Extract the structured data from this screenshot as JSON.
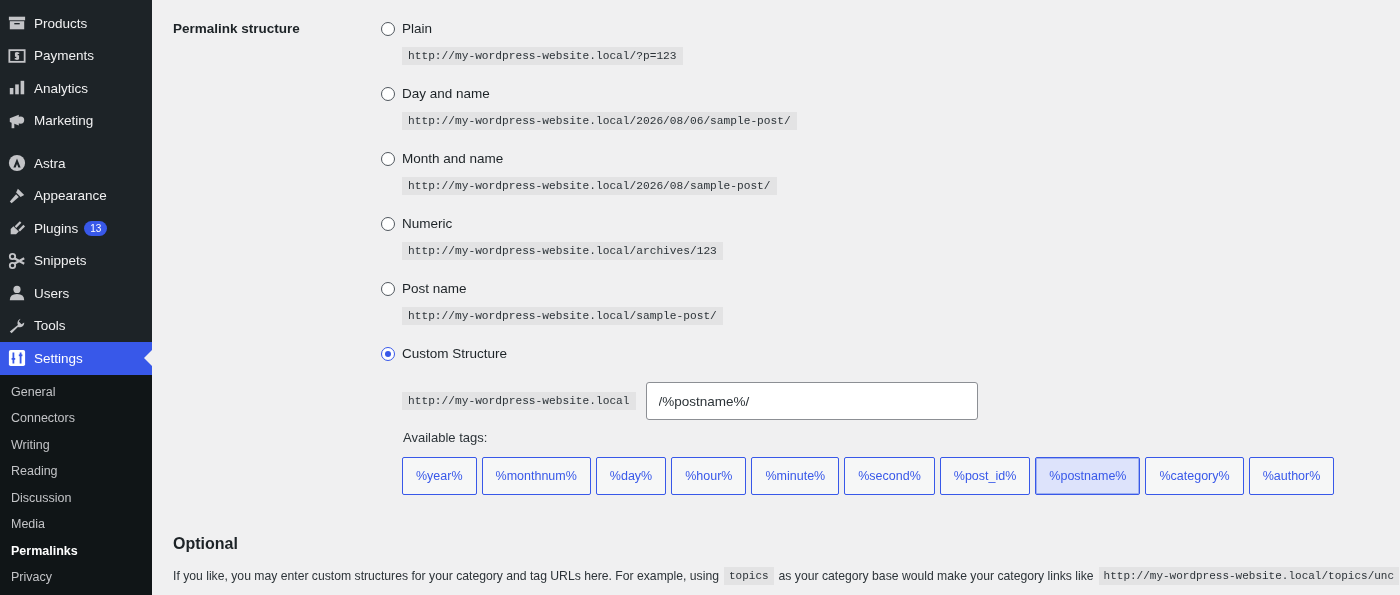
{
  "sidebar": {
    "menu_groups": [
      [
        {
          "label": "Products",
          "selected": false
        },
        {
          "label": "Payments",
          "selected": false
        },
        {
          "label": "Analytics",
          "selected": false
        },
        {
          "label": "Marketing",
          "selected": false
        }
      ],
      [
        {
          "label": "Astra",
          "selected": false
        },
        {
          "label": "Appearance",
          "selected": false
        },
        {
          "label": "Plugins",
          "selected": false,
          "badge": "13"
        },
        {
          "label": "Snippets",
          "selected": false
        },
        {
          "label": "Users",
          "selected": false
        },
        {
          "label": "Tools",
          "selected": false
        },
        {
          "label": "Settings",
          "selected": true
        }
      ]
    ],
    "submenu": [
      {
        "label": "General",
        "selected": false
      },
      {
        "label": "Connectors",
        "selected": false
      },
      {
        "label": "Writing",
        "selected": false
      },
      {
        "label": "Reading",
        "selected": false
      },
      {
        "label": "Discussion",
        "selected": false
      },
      {
        "label": "Media",
        "selected": false
      },
      {
        "label": "Permalinks",
        "selected": true
      },
      {
        "label": "Privacy",
        "selected": false
      }
    ]
  },
  "permalink": {
    "label": "Permalink structure",
    "options": [
      {
        "label": "Plain",
        "selected": false,
        "example": "http://my-wordpress-website.local/?p=123"
      },
      {
        "label": "Day and name",
        "selected": false,
        "example": "http://my-wordpress-website.local/2026/08/06/sample-post/"
      },
      {
        "label": "Month and name",
        "selected": false,
        "example": "http://my-wordpress-website.local/2026/08/sample-post/"
      },
      {
        "label": "Numeric",
        "selected": false,
        "example": "http://my-wordpress-website.local/archives/123"
      },
      {
        "label": "Post name",
        "selected": false,
        "example": "http://my-wordpress-website.local/sample-post/"
      },
      {
        "label": "Custom Structure",
        "selected": true
      }
    ],
    "custom_prefix": "http://my-wordpress-website.local",
    "custom_value": "/%postname%/",
    "tags_label": "Available tags:",
    "tags": [
      {
        "label": "%year%",
        "selected": false
      },
      {
        "label": "%monthnum%",
        "selected": false
      },
      {
        "label": "%day%",
        "selected": false
      },
      {
        "label": "%hour%",
        "selected": false
      },
      {
        "label": "%minute%",
        "selected": false
      },
      {
        "label": "%second%",
        "selected": false
      },
      {
        "label": "%post_id%",
        "selected": false
      },
      {
        "label": "%postname%",
        "selected": true
      },
      {
        "label": "%category%",
        "selected": false
      },
      {
        "label": "%author%",
        "selected": false
      }
    ]
  },
  "optional": {
    "heading": "Optional",
    "text_before": "If you like, you may enter custom structures for your category and tag URLs here. For example, using",
    "code": "topics",
    "text_after": "as your category base would make your category links like",
    "code_url": "http://my-wordpress-website.local/topics/unc"
  }
}
